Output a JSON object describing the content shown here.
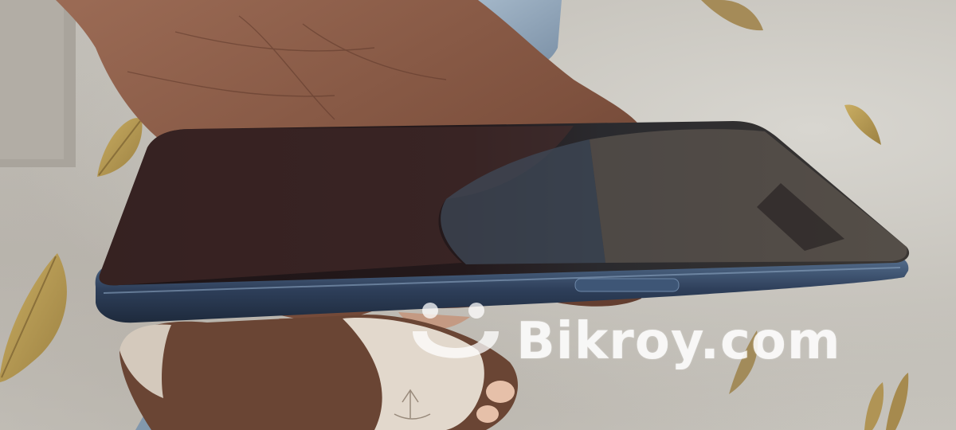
{
  "image": {
    "watermark_text": "Bikroy.com",
    "subject_icon": "smartphone-icon",
    "colors": {
      "floor": "#c2bfb8",
      "skin": "#8a5a44",
      "phone_body": "#2f3f5c",
      "screen": "#1c1517",
      "jeans": "#8fa3b8",
      "sandal": "#d8cfc4",
      "leaf": "#b59a55"
    }
  }
}
